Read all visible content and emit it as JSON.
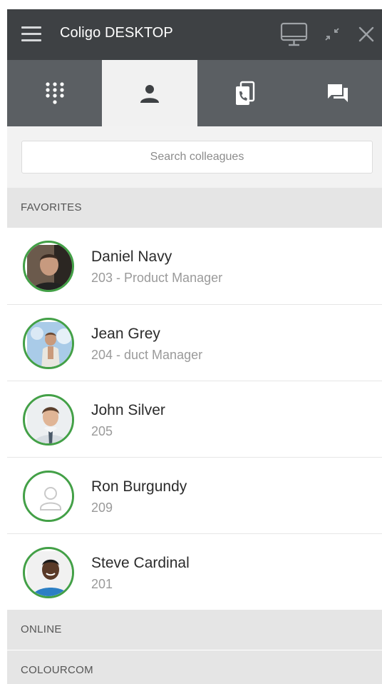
{
  "app": {
    "title": "Coligo DESKTOP"
  },
  "window_controls": {
    "screen_icon": "desktop-monitor-icon",
    "minimize_icon": "compress-arrows-icon",
    "close_icon": "close-x-icon"
  },
  "tabs": [
    {
      "icon": "dialpad-icon",
      "active": false
    },
    {
      "icon": "person-icon",
      "active": true
    },
    {
      "icon": "call-history-icon",
      "active": false
    },
    {
      "icon": "chat-bubbles-icon",
      "active": false
    }
  ],
  "search": {
    "placeholder": "Search colleagues",
    "value": ""
  },
  "sections": {
    "favorites": "FAVORITES",
    "online": "ONLINE",
    "colourcom": "COLOURCOM"
  },
  "contacts": [
    {
      "name": "Daniel Navy",
      "subtitle": "203 - Product Manager",
      "status_color": "#43a047",
      "avatar": "photo"
    },
    {
      "name": "Jean Grey",
      "subtitle": "204 - duct Manager",
      "status_color": "#43a047",
      "avatar": "photo"
    },
    {
      "name": "John Silver",
      "subtitle": "205",
      "status_color": "#43a047",
      "avatar": "photo"
    },
    {
      "name": "Ron Burgundy",
      "subtitle": "209",
      "status_color": "#43a047",
      "avatar": "placeholder"
    },
    {
      "name": "Steve Cardinal",
      "subtitle": "201",
      "status_color": "#43a047",
      "avatar": "photo"
    }
  ],
  "colors": {
    "titlebar": "#3e4144",
    "tabbar": "#5b5f63",
    "active_tab": "#f1f1f1",
    "online_ring": "#43a047",
    "section_header": "#e5e5e5"
  }
}
